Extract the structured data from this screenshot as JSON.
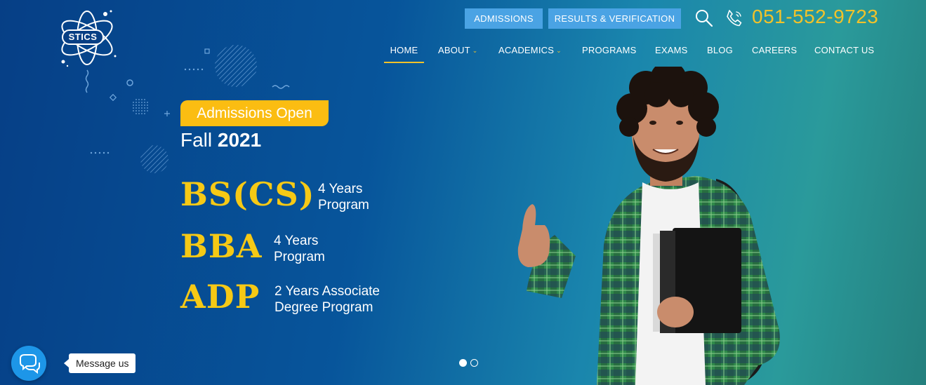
{
  "brand": {
    "logo_text": "STICS"
  },
  "topbar": {
    "admissions_label": "ADMISSIONS",
    "results_label": "RESULTS & VERIFICATION",
    "phone": "051-552-9723",
    "search_icon": "search-icon",
    "phone_icon": "phone-icon"
  },
  "nav": {
    "items": [
      {
        "label": "HOME",
        "active": true
      },
      {
        "label": "ABOUT",
        "dropdown": true
      },
      {
        "label": "ACADEMICS",
        "dropdown": true
      },
      {
        "label": "PROGRAMS"
      },
      {
        "label": "EXAMS"
      },
      {
        "label": "BLOG"
      },
      {
        "label": "CAREERS"
      },
      {
        "label": "CONTACT US"
      }
    ],
    "chevron": "⌄"
  },
  "hero": {
    "badge": "Admissions Open",
    "season": "Fall",
    "year": "2021",
    "programs": [
      {
        "name": "BS(CS)",
        "desc_line1": "4 Years",
        "desc_line2": "Program"
      },
      {
        "name": "BBA",
        "desc_line1": "4 Years",
        "desc_line2": "Program"
      },
      {
        "name": "ADP",
        "desc_line1": "2 Years Associate",
        "desc_line2": "Degree Program"
      }
    ]
  },
  "carousel": {
    "slides": 2,
    "active_slide": 1
  },
  "chat": {
    "label": "Message us",
    "icon": "chat-icon"
  },
  "colors": {
    "accent_yellow": "#f1c22a",
    "button_blue": "#4aa3e4",
    "background_start": "#063f86",
    "background_end": "#24807e"
  }
}
